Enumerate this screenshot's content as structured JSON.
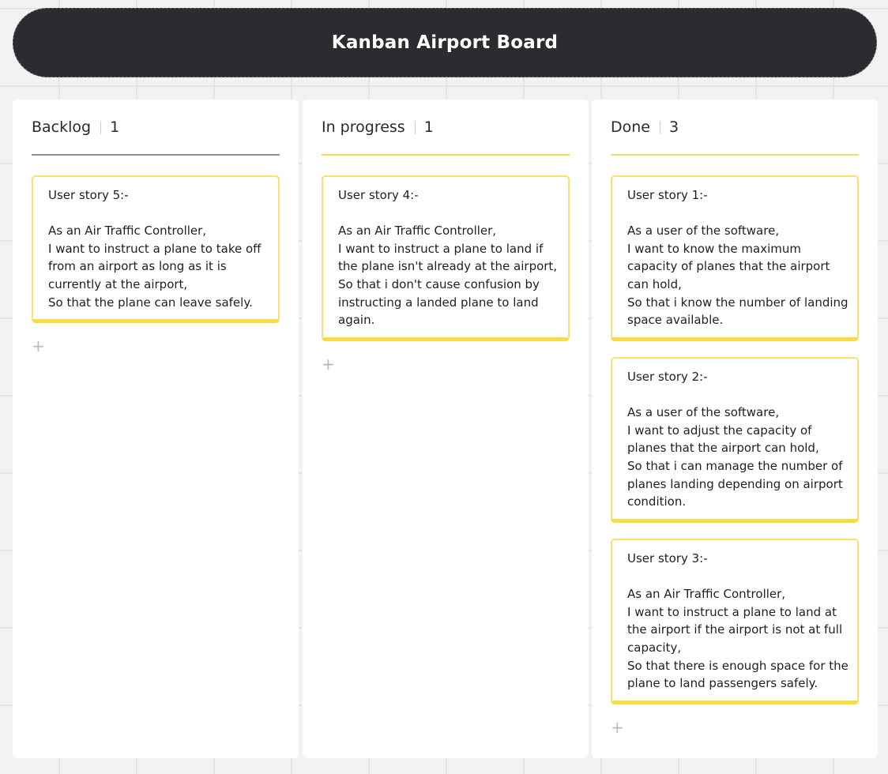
{
  "board": {
    "title": "Kanban Airport Board"
  },
  "columns": [
    {
      "title": "Backlog",
      "count": "1",
      "color": "#8f9095",
      "cards": [
        {
          "title": "User story 5:-",
          "lines": [
            "As an Air Traffic Controller,",
            "I want to instruct a plane to take off",
            "from an airport as long as it is",
            "currently at the airport,",
            "So that the plane can leave safely."
          ]
        }
      ],
      "add_icon": "plus-icon"
    },
    {
      "title": "In progress",
      "count": "1",
      "color": "#ffd94a",
      "cards": [
        {
          "title": "User story 4:-",
          "lines": [
            "As an Air Traffic Controller,",
            "I want to instruct a plane to land if",
            "the plane isn't already at the airport,",
            "So that i don't cause confusion by",
            "instructing a landed plane to land",
            "again."
          ]
        }
      ],
      "add_icon": "plus-icon"
    },
    {
      "title": "Done",
      "count": "3",
      "color": "#dbe870",
      "cards": [
        {
          "title": "User story 1:-",
          "lines": [
            "As a user of the software,",
            "I want to know the maximum",
            "capacity of planes that the airport",
            "can hold,",
            "So that i know the number of landing",
            "space available."
          ]
        },
        {
          "title": "User story 2:-",
          "lines": [
            "As a user of the software,",
            "I want to adjust the capacity of",
            "planes that the airport can hold,",
            "So that i can manage the number of",
            "planes landing depending on airport",
            "condition."
          ]
        },
        {
          "title": "User story 3:-",
          "lines": [
            "As an Air Traffic Controller,",
            "I want to instruct a plane to land at",
            "the airport if the airport is not at full",
            "capacity,",
            "So that there is enough space for the",
            "plane to land passengers safely."
          ]
        }
      ],
      "add_icon": "plus-icon"
    }
  ],
  "card_accent": "#fbdb45",
  "header_bg": "#2b2c30"
}
